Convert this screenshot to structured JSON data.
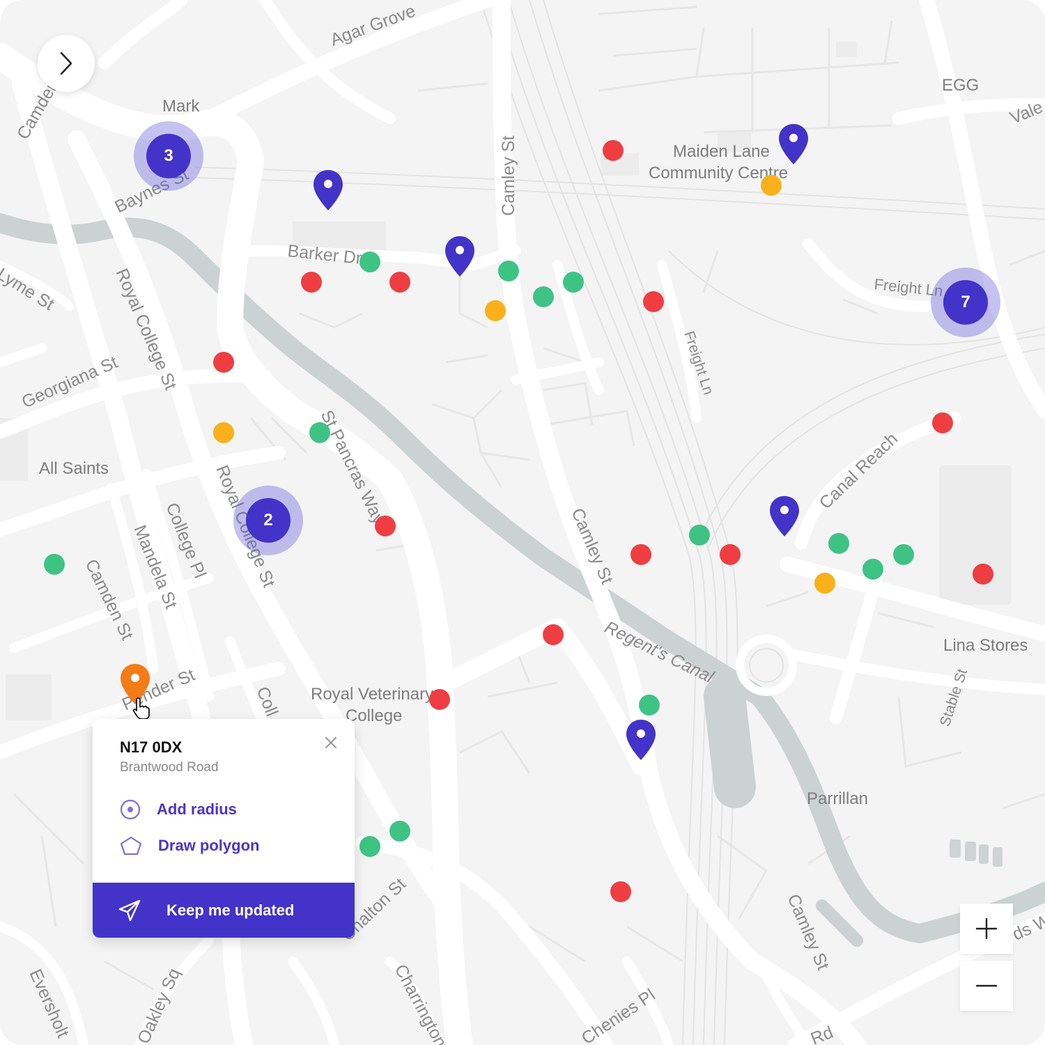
{
  "map": {
    "street_labels": [
      "Agar Grove",
      "Camden",
      "Mark",
      "Baynes St",
      "Camley St",
      "Maiden Lane",
      "Community Centre",
      "EGG",
      "Vale",
      "Barker Dr",
      "Lyme St",
      "Royal College St",
      "Freight Ln",
      "Freight Ln",
      "Georgiana St",
      "St Pancras Way",
      "All Saints",
      "Canal Reach",
      "Royal College St",
      "College Pl",
      "Mandela St",
      "Camden St",
      "Camley St",
      "Lina Stores",
      "Regent's Canal",
      "Pender St",
      "Coll",
      "Royal Veterinary",
      "College",
      "Stable St",
      "Parrillan",
      "Chalton St",
      "Camley St",
      "Charrington",
      "Eversholt",
      "Oakley Sq",
      "Chenies Pl",
      "Rd",
      "ds W"
    ],
    "status_colors": {
      "red": "#ef3e42",
      "green": "#3ec385",
      "amber": "#f9b01a"
    },
    "accent_color": "#4333c9",
    "selected_pin_color": "#f47b16",
    "clusters": [
      {
        "count": "3"
      },
      {
        "count": "2"
      },
      {
        "count": "7"
      }
    ],
    "markers": [
      {
        "status": "red"
      },
      {
        "status": "green"
      },
      {
        "status": "red"
      },
      {
        "status": "green"
      },
      {
        "status": "green"
      },
      {
        "status": "green"
      },
      {
        "status": "amber"
      },
      {
        "status": "red"
      },
      {
        "status": "red"
      },
      {
        "status": "amber"
      },
      {
        "status": "red"
      },
      {
        "status": "amber"
      },
      {
        "status": "green"
      },
      {
        "status": "red"
      },
      {
        "status": "red"
      },
      {
        "status": "green"
      },
      {
        "status": "red"
      },
      {
        "status": "green"
      },
      {
        "status": "green"
      },
      {
        "status": "green"
      },
      {
        "status": "amber"
      },
      {
        "status": "red"
      },
      {
        "status": "green"
      },
      {
        "status": "red"
      },
      {
        "status": "red"
      },
      {
        "status": "green"
      },
      {
        "status": "green"
      },
      {
        "status": "green"
      },
      {
        "status": "red"
      }
    ],
    "pin_icon": "map-pin-icon"
  },
  "sidebar_toggle": {
    "icon": "chevron-right-icon"
  },
  "popup": {
    "postcode": "N17 0DX",
    "street": "Brantwood Road",
    "close_icon": "close-icon",
    "actions": [
      {
        "label": "Add radius",
        "icon": "radius-icon"
      },
      {
        "label": "Draw polygon",
        "icon": "polygon-icon"
      }
    ],
    "cta": {
      "label": "Keep me updated",
      "icon": "send-icon"
    }
  },
  "zoom": {
    "in_icon": "plus-icon",
    "out_icon": "minus-icon"
  }
}
